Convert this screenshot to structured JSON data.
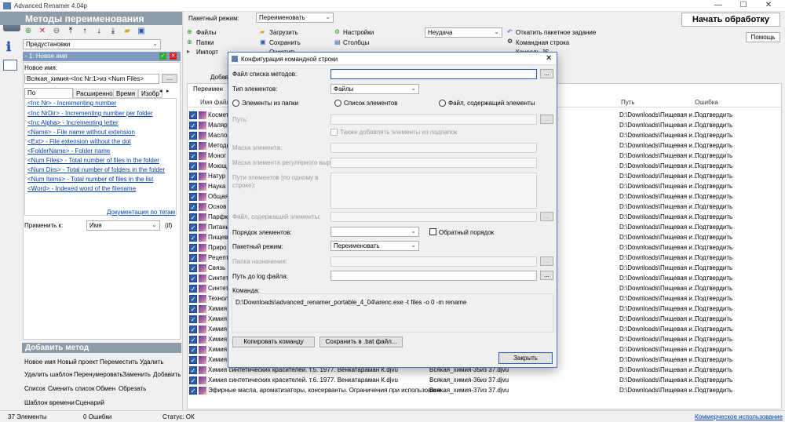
{
  "app": {
    "title": "Advanced Renamer 4.04p"
  },
  "left": {
    "header": "Методы переименования",
    "preset_label": "Предустановки",
    "method_item": "- 1: Новое имя",
    "new_name_label": "Новое имя:",
    "new_name_value": "Всякая_химия-<Inc Nr:1>из <Num Files>",
    "dots": "...",
    "tabs": [
      "По умолчанию",
      "Расширенно",
      "Время",
      "Изобр"
    ],
    "tags": [
      "<Inc Nr> - Incrementing number",
      "<Inc NrDir> - Incrementing number per folder",
      "<Inc Alpha> - Incrementing letter",
      "<Name> - File name without extension",
      "<Ext> - File extension without the dot",
      "<FolderName> - Folder name",
      "<Num Files> - Total number of files in the folder",
      "<Num Dirs> - Total number of folders in the folder",
      "<Num Items> - Total number of files in the list",
      "<Word> - Indexed word of the filename"
    ],
    "doc_link": "Документация по тегам",
    "apply_label": "Применить к:",
    "apply_value": "Имя",
    "apply_if": "(if)",
    "add_header": "Добавить метод",
    "add_methods": [
      [
        "Новое имя",
        "Новый проект",
        "Переместить",
        "Удалить"
      ],
      [
        "Удалить шаблон",
        "Перенумеровать",
        "Заменить",
        "Добавить"
      ],
      [
        "Список",
        "Сменить список",
        "Обмен",
        "Обрезать"
      ],
      [
        "Шаблон времени",
        "Сценарий"
      ]
    ]
  },
  "top": {
    "batch_label": "Пакетный режим:",
    "batch_value": "Переименовать",
    "start": "Начать обработку",
    "help": "Помощь",
    "files": "Файлы",
    "folders": "Папки",
    "import": "Импорт",
    "load": "Загрузить",
    "save": "Сохранить",
    "clear": "Очистить",
    "settings": "Настройки",
    "columns": "Столбцы",
    "status_value": "Неудача",
    "undo": "Откатить пакетное задание",
    "cmdline": "Командная строка",
    "console": "Консоль JS"
  },
  "list": {
    "tab_partial": "Переимен",
    "add_partial": "Добав",
    "col_name": "Имя файла",
    "col_path": "Путь",
    "col_err": "Ошибка",
    "rows": [
      {
        "name": "Космет",
        "path": "D:\\Downloads\\Пищевая и...",
        "err": "Подтвердить"
      },
      {
        "name": "Маляр",
        "path": "D:\\Downloads\\Пищевая и...",
        "err": "Подтвердить"
      },
      {
        "name": "Маслоз",
        "path": "D:\\Downloads\\Пищевая и...",
        "err": "Подтвердить"
      },
      {
        "name": "Методы",
        "path": "D:\\Downloads\\Пищевая и...",
        "err": "Подтвердить"
      },
      {
        "name": "Моног",
        "path": "D:\\Downloads\\Пищевая и...",
        "err": "Подтвердить"
      },
      {
        "name": "Моющ",
        "path": "D:\\Downloads\\Пищевая и...",
        "err": "Подтвердить"
      },
      {
        "name": "Натур",
        "path": "D:\\Downloads\\Пищевая и...",
        "err": "Подтвердить"
      },
      {
        "name": "Наука",
        "path": "D:\\Downloads\\Пищевая и...",
        "err": "Подтвердить"
      },
      {
        "name": "Общая",
        "path": "D:\\Downloads\\Пищевая и...",
        "err": "Подтвердить"
      },
      {
        "name": "Основ",
        "path": "D:\\Downloads\\Пищевая и...",
        "err": "Подтвердить"
      },
      {
        "name": "Парфю",
        "path": "D:\\Downloads\\Пищевая и...",
        "err": "Подтвердить"
      },
      {
        "name": "Питани",
        "path": "D:\\Downloads\\Пищевая и...",
        "err": "Подтвердить"
      },
      {
        "name": "Пищев",
        "path": "D:\\Downloads\\Пищевая и...",
        "err": "Подтвердить"
      },
      {
        "name": "Приро",
        "path": "D:\\Downloads\\Пищевая и...",
        "err": "Подтвердить"
      },
      {
        "name": "Рецепт",
        "path": "D:\\Downloads\\Пищевая и...",
        "err": "Подтвердить"
      },
      {
        "name": "Связь",
        "path": "D:\\Downloads\\Пищевая и...",
        "err": "Подтвердить"
      },
      {
        "name": "Синтет",
        "path": "D:\\Downloads\\Пищевая и...",
        "err": "Подтвердить"
      },
      {
        "name": "Синтет",
        "path": "D:\\Downloads\\Пищевая и...",
        "err": "Подтвердить"
      },
      {
        "name": "Технол",
        "path": "D:\\Downloads\\Пищевая и...",
        "err": "Подтвердить"
      },
      {
        "name": "Химия",
        "path": "D:\\Downloads\\Пищевая и...",
        "err": "Подтвердить"
      },
      {
        "name": "Химия",
        "path": "D:\\Downloads\\Пищевая и...",
        "err": "Подтвердить"
      },
      {
        "name": "Химия",
        "path": "D:\\Downloads\\Пищевая и...",
        "err": "Подтвердить"
      },
      {
        "name": "Химия",
        "path": "D:\\Downloads\\Пищевая и...",
        "err": "Подтвердить"
      },
      {
        "name": "Химия",
        "path": "D:\\Downloads\\Пищевая и...",
        "err": "Подтвердить"
      },
      {
        "name": "Химия синтетических красителей. т.4. 1975. Венкатараман К.djvu",
        "new": "Всякая_химия-34из 37.djvu",
        "path": "D:\\Downloads\\Пищевая и...",
        "err": "Подтвердить"
      },
      {
        "name": "Химия синтетических красителей. т.5. 1977. Венкатараман К.djvu",
        "new": "Всякая_химия-35из 37.djvu",
        "path": "D:\\Downloads\\Пищевая и...",
        "err": "Подтвердить"
      },
      {
        "name": "Химия синтетических красителей. т.6. 1977. Венкатараман К.djvu",
        "new": "Всякая_химия-36из 37.djvu",
        "path": "D:\\Downloads\\Пищевая и...",
        "err": "Подтвердить"
      },
      {
        "name": "Эфирные масла, ароматизаторы, консерванты. Ограничения при использовани...",
        "new": "Всякая_химия-37из 37.djvu",
        "path": "D:\\Downloads\\Пищевая и...",
        "err": "Подтвердить"
      }
    ]
  },
  "status": {
    "items": "37 Элементы",
    "errors": "0 Ошибки",
    "state": "Статус: ОК",
    "commercial": "Коммерческое использование"
  },
  "dialog": {
    "title": "Конфигурация командной строки",
    "methods_file": "Файл списка методов:",
    "item_type": "Тип элементов:",
    "item_type_value": "Файлы",
    "radio1": "Элементы из папки",
    "radio2": "Список элементов",
    "radio3": "Файл, содержащий элементы",
    "path": "Путь:",
    "subfolders": "Также добавлять элементы из подпапок",
    "mask": "Маска элемента:",
    "regex_mask": "Маска элемента регулярного выраж",
    "paths": "Пути элементов (по одному в строке):",
    "file_items": "Файл, содержащий элементы:",
    "order": "Порядок элементов:",
    "reverse": "Обратный порядок",
    "batch": "Пакетный режим:",
    "batch_value": "Переименовать",
    "dest": "Папка назначения:",
    "log": "Путь до log файла:",
    "command_label": "Команда:",
    "command": "D:\\Downloads\\advanced_renamer_portable_4_04\\arenc.exe -t files -o 0 -m rename",
    "copy_btn": "Копировать команду",
    "save_btn": "Сохранить в .bat файл...",
    "close_btn": "Закрыть",
    "dots": "..."
  }
}
